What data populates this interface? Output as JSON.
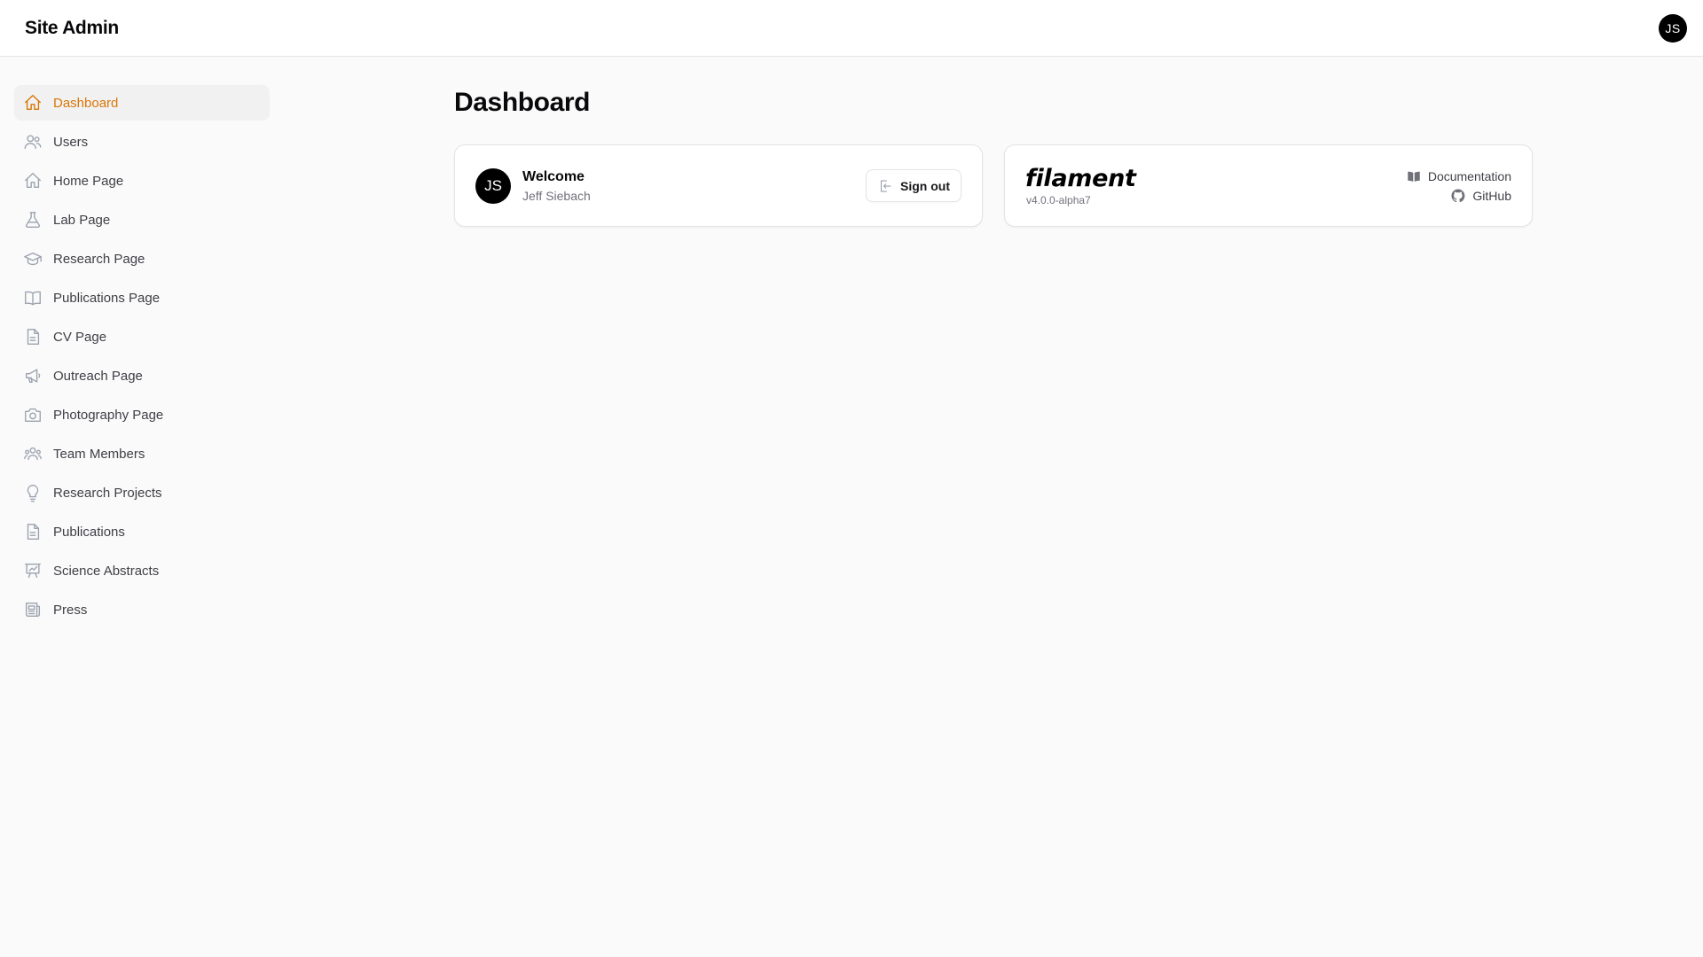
{
  "header": {
    "brand": "Site Admin",
    "user_initials": "JS"
  },
  "sidebar": {
    "items": [
      {
        "label": "Dashboard",
        "icon": "home-icon",
        "active": true
      },
      {
        "label": "Users",
        "icon": "users-icon"
      },
      {
        "label": "Home Page",
        "icon": "home-icon"
      },
      {
        "label": "Lab Page",
        "icon": "beaker-icon"
      },
      {
        "label": "Research Page",
        "icon": "academic-cap-icon"
      },
      {
        "label": "Publications Page",
        "icon": "book-open-icon"
      },
      {
        "label": "CV Page",
        "icon": "document-icon"
      },
      {
        "label": "Outreach Page",
        "icon": "megaphone-icon"
      },
      {
        "label": "Photography Page",
        "icon": "camera-icon"
      },
      {
        "label": "Team Members",
        "icon": "user-group-icon"
      },
      {
        "label": "Research Projects",
        "icon": "light-bulb-icon"
      },
      {
        "label": "Publications",
        "icon": "document-text-icon"
      },
      {
        "label": "Science Abstracts",
        "icon": "presentation-chart-icon"
      },
      {
        "label": "Press",
        "icon": "newspaper-icon"
      }
    ]
  },
  "main": {
    "title": "Dashboard",
    "welcome_card": {
      "initials": "JS",
      "title": "Welcome",
      "name": "Jeff Siebach",
      "signout_label": "Sign out"
    },
    "filament_card": {
      "logo": "filament",
      "version": "v4.0.0-alpha7",
      "documentation_label": "Documentation",
      "github_label": "GitHub"
    }
  },
  "colors": {
    "accent": "#d97706",
    "icon_gray": "#9ca3af",
    "background": "#fafafa"
  }
}
